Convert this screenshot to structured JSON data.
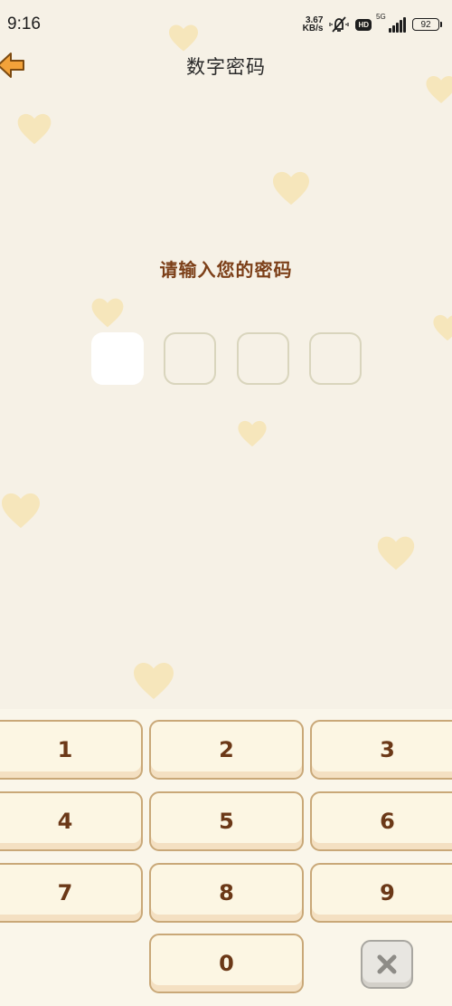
{
  "status_bar": {
    "time": "9:16",
    "net_speed_value": "3.67",
    "net_speed_unit": "KB/s",
    "hd_label": "HD",
    "network_label": "5G",
    "battery": "92"
  },
  "header": {
    "title": "数字密码",
    "back_icon": "arrow-left-icon"
  },
  "prompt": "请输入您的密码",
  "pin": {
    "length": 4,
    "active_index": 0
  },
  "keypad": {
    "keys": [
      "1",
      "2",
      "3",
      "4",
      "5",
      "6",
      "7",
      "8",
      "9",
      "0"
    ],
    "delete_icon": "close-icon"
  },
  "colors": {
    "background": "#f6f1e6",
    "prompt_text": "#7c3f18",
    "key_text": "#6b3817",
    "key_border": "#c9a878",
    "back_arrow": "#f2a23a",
    "heart": "#f6e6bb"
  }
}
